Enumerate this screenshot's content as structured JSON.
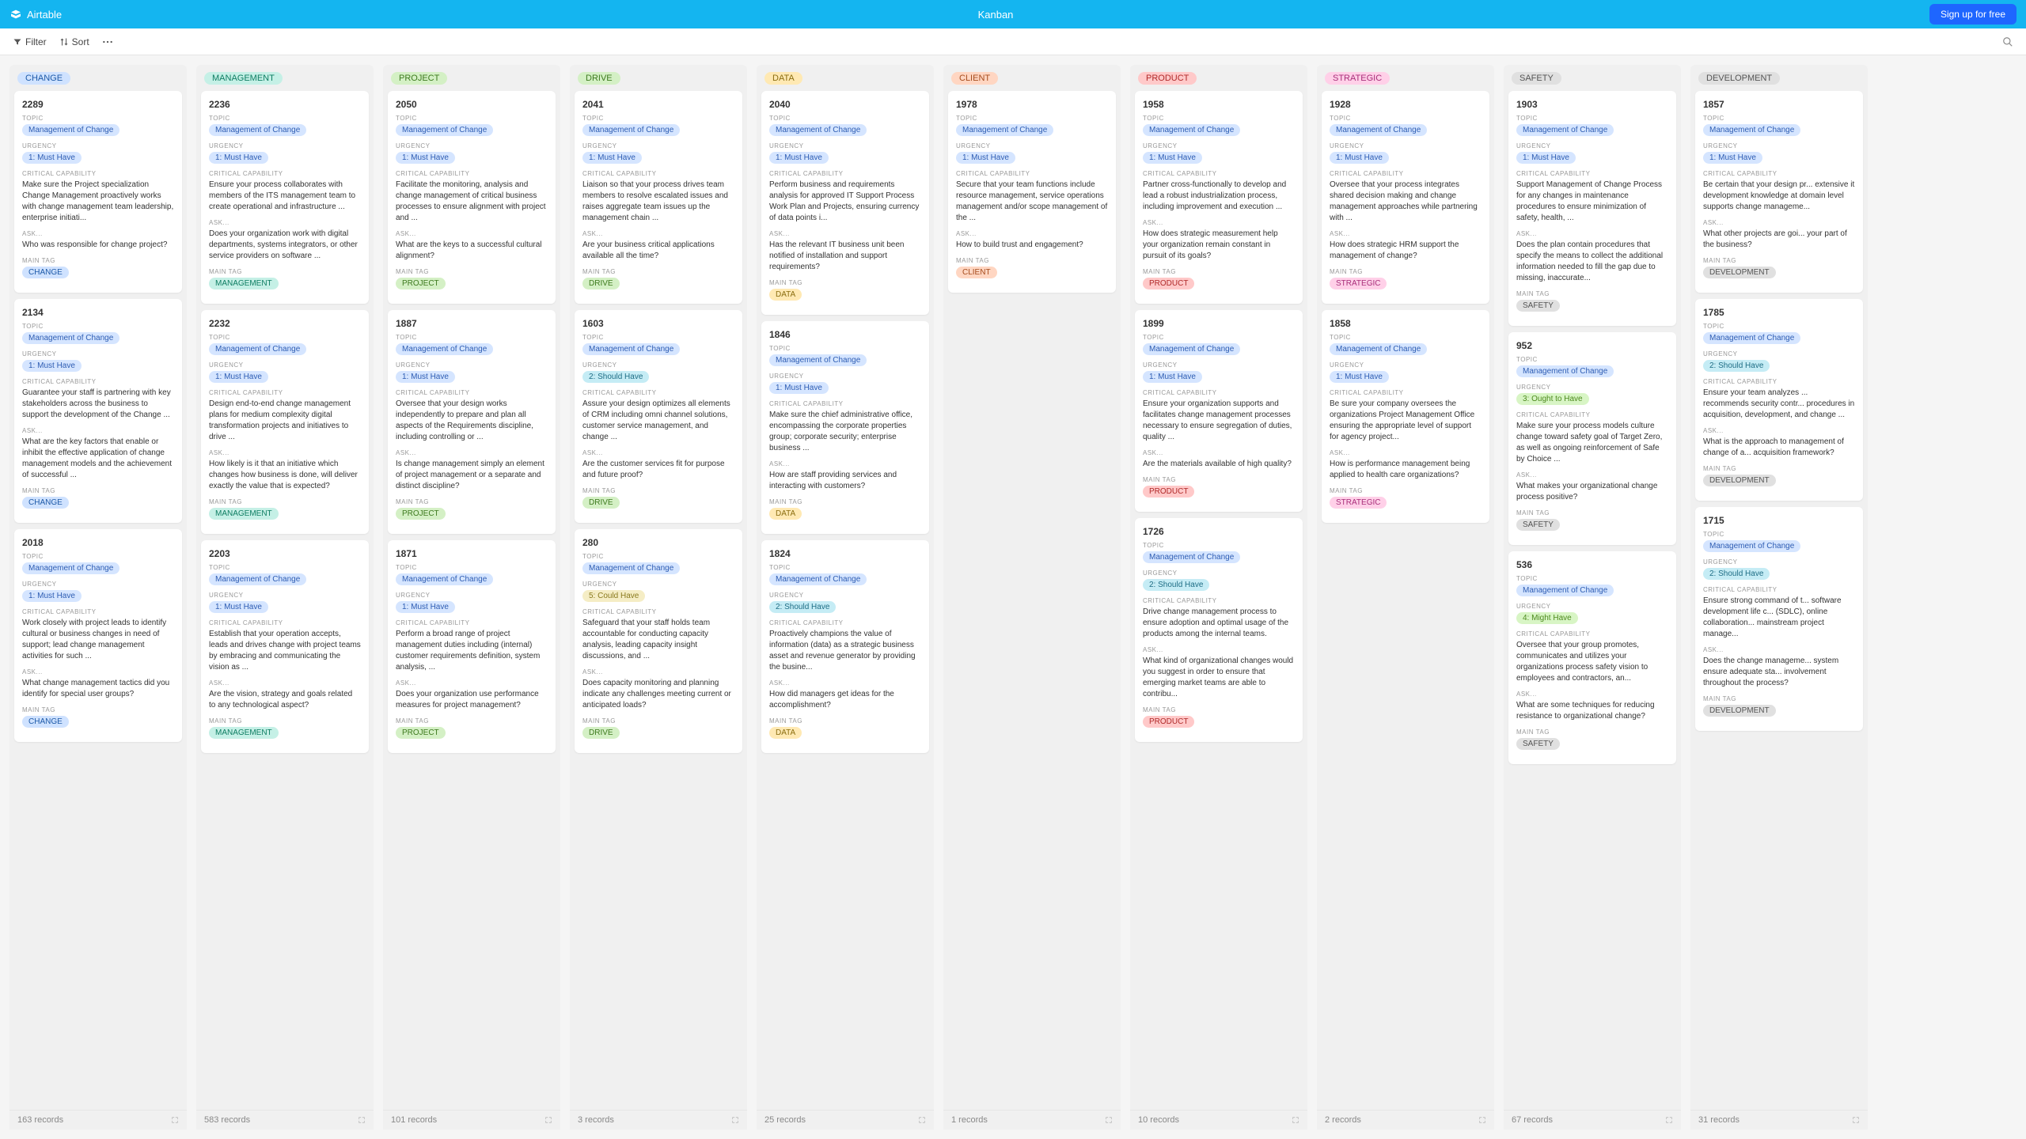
{
  "brand": "Airtable",
  "view_title": "Kanban",
  "signup_label": "Sign up for free",
  "toolbar": {
    "filter": "Filter",
    "sort": "Sort"
  },
  "field_labels": {
    "topic": "TOPIC",
    "urgency": "URGENCY",
    "critical": "CRITICAL CAPABILITY",
    "ask": "ASK...",
    "main_tag": "MAIN TAG"
  },
  "columns": [
    {
      "name": "CHANGE",
      "pill": "pill-blue",
      "tag_pill": "pill-blue",
      "footer": "163 records",
      "cards": [
        {
          "id": "2289",
          "topic": "Management of Change",
          "urgency": "1: Must Have",
          "urg_pill": "pill-lightblue",
          "critical": "Make sure the Project specialization Change Management proactively works with change management team leadership, enterprise initiati...",
          "ask": "Who was responsible for change project?",
          "tag": "CHANGE"
        },
        {
          "id": "2134",
          "topic": "Management of Change",
          "urgency": "1: Must Have",
          "urg_pill": "pill-lightblue",
          "critical": "Guarantee your staff is partnering with key stakeholders across the business to support the development of the Change ...",
          "ask": "What are the key factors that enable or inhibit the effective application of change management models and the achievement of successful ...",
          "tag": "CHANGE"
        },
        {
          "id": "2018",
          "topic": "Management of Change",
          "urgency": "1: Must Have",
          "urg_pill": "pill-lightblue",
          "critical": "Work closely with project leads to identify cultural or business changes in need of support; lead change management activities for such ...",
          "ask": "What change management tactics did you identify for special user groups?",
          "tag": "CHANGE"
        }
      ]
    },
    {
      "name": "MANAGEMENT",
      "pill": "pill-teal",
      "tag_pill": "pill-teal",
      "footer": "583 records",
      "cards": [
        {
          "id": "2236",
          "topic": "Management of Change",
          "urgency": "1: Must Have",
          "urg_pill": "pill-lightblue",
          "critical": "Ensure your process collaborates with members of the ITS management team to create operational and infrastructure ...",
          "ask": "Does your organization work with digital departments, systems integrators, or other service providers on software ...",
          "tag": "MANAGEMENT"
        },
        {
          "id": "2232",
          "topic": "Management of Change",
          "urgency": "1: Must Have",
          "urg_pill": "pill-lightblue",
          "critical": "Design end-to-end change management plans for medium complexity digital transformation projects and initiatives to drive ...",
          "ask": "How likely is it that an initiative which changes how business is done, will deliver exactly the value that is expected?",
          "tag": "MANAGEMENT"
        },
        {
          "id": "2203",
          "topic": "Management of Change",
          "urgency": "1: Must Have",
          "urg_pill": "pill-lightblue",
          "critical": "Establish that your operation accepts, leads and drives change with project teams by embracing and communicating the vision as ...",
          "ask": "Are the vision, strategy and goals related to any technological aspect?",
          "tag": "MANAGEMENT"
        }
      ]
    },
    {
      "name": "PROJECT",
      "pill": "pill-green",
      "tag_pill": "pill-green",
      "footer": "101 records",
      "cards": [
        {
          "id": "2050",
          "topic": "Management of Change",
          "urgency": "1: Must Have",
          "urg_pill": "pill-lightblue",
          "critical": "Facilitate the monitoring, analysis and change management of critical business processes to ensure alignment with project and ...",
          "ask": "What are the keys to a successful cultural alignment?",
          "tag": "PROJECT"
        },
        {
          "id": "1887",
          "topic": "Management of Change",
          "urgency": "1: Must Have",
          "urg_pill": "pill-lightblue",
          "critical": "Oversee that your design works independently to prepare and plan all aspects of the Requirements discipline, including controlling or ...",
          "ask": "Is change management simply an element of project management or a separate and distinct discipline?",
          "tag": "PROJECT"
        },
        {
          "id": "1871",
          "topic": "Management of Change",
          "urgency": "1: Must Have",
          "urg_pill": "pill-lightblue",
          "critical": "Perform a broad range of project management duties including (internal) customer requirements definition, system analysis, ...",
          "ask": "Does your organization use performance measures for project management?",
          "tag": "PROJECT"
        }
      ]
    },
    {
      "name": "DRIVE",
      "pill": "pill-green",
      "tag_pill": "pill-green",
      "footer": "",
      "cards": [
        {
          "id": "2041",
          "topic": "Management of Change",
          "urgency": "1: Must Have",
          "urg_pill": "pill-lightblue",
          "critical": "Liaison so that your process drives team members to resolve escalated issues and raises aggregate team issues up the management chain ...",
          "ask": "Are your business critical applications available all the time?",
          "tag": "DRIVE"
        },
        {
          "id": "1603",
          "topic": "Management of Change",
          "urgency": "2: Should Have",
          "urg_pill": "pill-cyan",
          "critical": "Assure your design optimizes all elements of CRM including omni channel solutions, customer service management, and change ...",
          "ask": "Are the customer services fit for purpose and future proof?",
          "tag": "DRIVE"
        },
        {
          "id": "280",
          "topic": "Management of Change",
          "urgency": "5: Could Have",
          "urg_pill": "pill-lightyellow",
          "critical": "Safeguard that your staff holds team accountable for conducting capacity analysis, leading capacity insight discussions, and ...",
          "ask": "Does capacity monitoring and planning indicate any challenges meeting current or anticipated loads?",
          "tag": "DRIVE"
        }
      ],
      "footer_override": "3 records"
    },
    {
      "name": "DATA",
      "pill": "pill-yellow",
      "tag_pill": "pill-yellow",
      "footer": "25 records",
      "cards": [
        {
          "id": "2040",
          "topic": "Management of Change",
          "urgency": "1: Must Have",
          "urg_pill": "pill-lightblue",
          "critical": "Perform business and requirements analysis for approved IT Support Process Work Plan and Projects, ensuring currency of data points i...",
          "ask": "Has the relevant IT business unit been notified of installation and support requirements?",
          "tag": "DATA"
        },
        {
          "id": "1846",
          "topic": "Management of Change",
          "urgency": "1: Must Have",
          "urg_pill": "pill-lightblue",
          "critical": "Make sure the chief administrative office, encompassing the corporate properties group; corporate security; enterprise business ...",
          "ask": "How are staff providing services and interacting with customers?",
          "tag": "DATA"
        },
        {
          "id": "1824",
          "topic": "Management of Change",
          "urgency": "2: Should Have",
          "urg_pill": "pill-cyan",
          "critical": "Proactively champions the value of information (data) as a strategic business asset and revenue generator by providing the busine...",
          "ask": "How did managers get ideas for the accomplishment?",
          "tag": "DATA"
        }
      ]
    },
    {
      "name": "CLIENT",
      "pill": "pill-orange",
      "tag_pill": "pill-orange",
      "footer": "",
      "footer_override": "1 records",
      "cards": [
        {
          "id": "1978",
          "topic": "Management of Change",
          "urgency": "1: Must Have",
          "urg_pill": "pill-lightblue",
          "critical": "Secure that your team functions include resource management, service operations management and/or scope management of the ...",
          "ask": "How to build trust and engagement?",
          "tag": "CLIENT"
        }
      ]
    },
    {
      "name": "PRODUCT",
      "pill": "pill-red",
      "tag_pill": "pill-red",
      "footer": "10 records",
      "cards": [
        {
          "id": "1958",
          "topic": "Management of Change",
          "urgency": "1: Must Have",
          "urg_pill": "pill-lightblue",
          "critical": "Partner cross-functionally to develop and lead a robust industrialization process, including improvement and execution ...",
          "ask": "How does strategic measurement help your organization remain constant in pursuit of its goals?",
          "tag": "PRODUCT"
        },
        {
          "id": "1899",
          "topic": "Management of Change",
          "urgency": "1: Must Have",
          "urg_pill": "pill-lightblue",
          "critical": "Ensure your organization supports and facilitates change management processes necessary to ensure segregation of duties, quality ...",
          "ask": "Are the materials available of high quality?",
          "tag": "PRODUCT"
        },
        {
          "id": "1726",
          "topic": "Management of Change",
          "urgency": "2: Should Have",
          "urg_pill": "pill-cyan",
          "critical": "Drive change management process to ensure adoption and optimal usage of the products among the internal teams.",
          "ask": "What kind of organizational changes would you suggest in order to ensure that emerging market teams are able to contribu...",
          "tag": "PRODUCT"
        }
      ]
    },
    {
      "name": "STRATEGIC",
      "pill": "pill-pink",
      "tag_pill": "pill-pink",
      "footer": "",
      "footer_override": "2 records",
      "cards": [
        {
          "id": "1928",
          "topic": "Management of Change",
          "urgency": "1: Must Have",
          "urg_pill": "pill-lightblue",
          "critical": "Oversee that your process integrates shared decision making and change management approaches while partnering with ...",
          "ask": "How does strategic HRM support the management of change?",
          "tag": "STRATEGIC"
        },
        {
          "id": "1858",
          "topic": "Management of Change",
          "urgency": "1: Must Have",
          "urg_pill": "pill-lightblue",
          "critical": "Be sure your company oversees the organizations Project Management Office ensuring the appropriate level of support for agency project...",
          "ask": "How is performance management being applied to health care organizations?",
          "tag": "STRATEGIC"
        }
      ]
    },
    {
      "name": "SAFETY",
      "pill": "pill-gray",
      "tag_pill": "pill-gray",
      "footer": "67 records",
      "cards": [
        {
          "id": "1903",
          "topic": "Management of Change",
          "urgency": "1: Must Have",
          "urg_pill": "pill-lightblue",
          "critical": "Support Management of Change Process for any changes in maintenance procedures to ensure minimization of safety, health, ...",
          "ask": "Does the plan contain procedures that specify the means to collect the additional information needed to fill the gap due to missing, inaccurate...",
          "tag": "SAFETY"
        },
        {
          "id": "952",
          "topic": "Management of Change",
          "urgency": "3: Ought to Have",
          "urg_pill": "pill-lightgreen",
          "critical": "Make sure your process models culture change toward safety goal of Target Zero, as well as ongoing reinforcement of Safe by Choice ...",
          "ask": "What makes your organizational change process positive?",
          "tag": "SAFETY"
        },
        {
          "id": "536",
          "topic": "Management of Change",
          "urgency": "4: Might Have",
          "urg_pill": "pill-lightgreen",
          "critical": "Oversee that your group promotes, communicates and utilizes your organizations process safety vision to employees and contractors, an...",
          "ask": "What are some techniques for reducing resistance to organizational change?",
          "tag": "SAFETY"
        }
      ]
    },
    {
      "name": "DEVELOPMENT",
      "pill": "pill-gray",
      "tag_pill": "pill-gray",
      "footer": "31 records",
      "cards": [
        {
          "id": "1857",
          "topic": "Management of Change",
          "urgency": "1: Must Have",
          "urg_pill": "pill-lightblue",
          "critical": "Be certain that your design pr... extensive it development knowledge at domain level supports change manageme...",
          "ask": "What other projects are goi... your part of the business?",
          "tag": "DEVELOPMENT"
        },
        {
          "id": "1785",
          "topic": "Management of Change",
          "urgency": "2: Should Have",
          "urg_pill": "pill-cyan",
          "critical": "Ensure your team analyzes ... recommends security contr... procedures in acquisition, development, and change ...",
          "ask": "What is the approach to management of change of a... acquisition framework?",
          "tag": "DEVELOPMENT"
        },
        {
          "id": "1715",
          "topic": "Management of Change",
          "urgency": "2: Should Have",
          "urg_pill": "pill-cyan",
          "critical": "Ensure strong command of t... software development life c... (SDLC), online collaboration... mainstream project manage...",
          "ask": "Does the change manageme... system ensure adequate sta... involvement throughout the process?",
          "tag": "DEVELOPMENT"
        }
      ]
    }
  ]
}
